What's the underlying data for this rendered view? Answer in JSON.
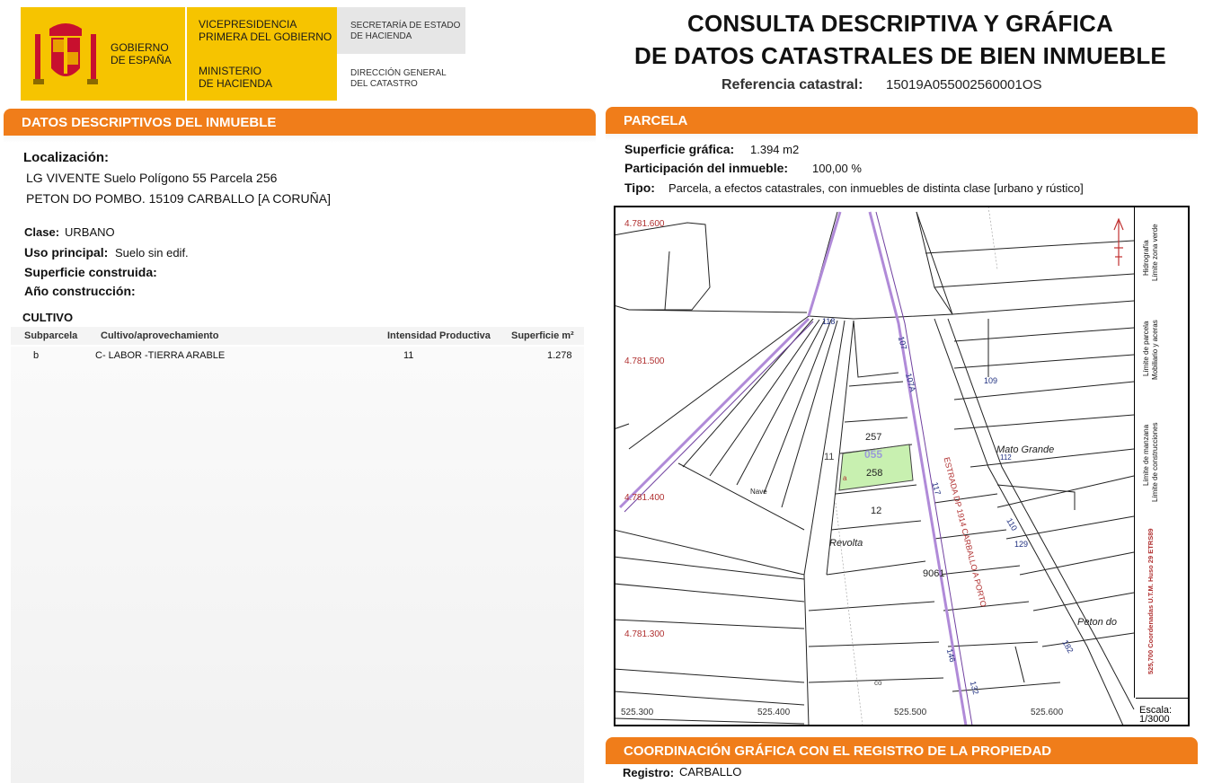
{
  "header": {
    "gov_name": "GOBIERNO\nDE ESPAÑA",
    "vicepresidencia": "VICEPRESIDENCIA\nPRIMERA DEL GOBIERNO",
    "ministerio": "MINISTERIO\nDE HACIENDA",
    "secretaria": "SECRETARÍA DE ESTADO\nDE HACIENDA",
    "direccion": "DIRECCIÓN GENERAL\nDEL CATASTRO",
    "title": "CONSULTA DESCRIPTIVA Y GRÁFICA\nDE DATOS CATASTRALES DE BIEN INMUEBLE",
    "ref_label": "Referencia catastral:",
    "ref_value": "15019A055002560001OS"
  },
  "datos": {
    "section_title": "DATOS DESCRIPTIVOS DEL INMUEBLE",
    "localizacion_label": "Localización:",
    "localizacion_line1": "LG VIVENTE  Suelo Polígono 55 Parcela 256",
    "localizacion_line2": "PETON DO POMBO. 15109 CARBALLO [A CORUÑA]",
    "clase_label": "Clase:",
    "clase_value": "URBANO",
    "uso_label": "Uso principal:",
    "uso_value": "Suelo sin edif.",
    "superficie_label": "Superficie construida:",
    "anio_label": "Año construcción:"
  },
  "cultivo": {
    "title": "CULTIVO",
    "headers": [
      "Subparcela",
      "Cultivo/aprovechamiento",
      "Intensidad Productiva",
      "Superficie m²"
    ],
    "rows": [
      [
        "b",
        "C- LABOR -TIERRA ARABLE",
        "11",
        "1.278"
      ]
    ]
  },
  "parcela": {
    "section_title": "PARCELA",
    "superficie_label": "Superficie gráfica:",
    "superficie_value": "1.394 m2",
    "participacion_label": "Participación del inmueble:",
    "participacion_value": "100,00 %",
    "tipo_label": "Tipo:",
    "tipo_value": "Parcela, a efectos catastrales, con inmuebles de distinta clase [urbano y rústico]"
  },
  "map": {
    "y_labels": [
      "4.781.600",
      "4.781.500",
      "4.781.400",
      "4.781.300"
    ],
    "x_labels": [
      "525.300",
      "525.400",
      "525.500",
      "525.600"
    ],
    "labels": {
      "l118": "118",
      "l107": "107",
      "l107a": "107A",
      "l109": "109",
      "l257": "257",
      "l055": "055",
      "l258": "258",
      "l11": "11",
      "la": "a",
      "l12": "12",
      "lnave": "Nave",
      "lrevolta": "Revolta",
      "l9061": "9061",
      "lmato": "Mato Grande",
      "l112": "112",
      "l110": "110",
      "l129": "129",
      "l117": "117",
      "lroad": "ESTRADA DP 1914 CARBALLO A PORTO",
      "l146": "146",
      "lpeton": "Peton do",
      "l182": "182",
      "l132": "132",
      "lco": "co"
    },
    "legend": {
      "hidrografia": "Hidrografía",
      "zona_verde": "Límite zona verde",
      "parcela": "Límite de parcela",
      "mobiliario": "Mobiliario y aceras",
      "manzana": "Límite de manzana",
      "construcciones": "Límite de construcciones",
      "coords": "525,700 Coordenadas U.T.M. Huso 29 ETRS89"
    },
    "scale_label": "Escala:",
    "scale_value": "1/3000",
    "colors": {
      "highlight": "#c8f0b0",
      "road": "#a070d8",
      "grid_label": "#b03030"
    }
  },
  "coordinacion": {
    "section_title": "COORDINACIÓN GRÁFICA CON EL REGISTRO DE LA PROPIEDAD",
    "registro_label": "Registro:",
    "registro_value": "CARBALLO"
  }
}
